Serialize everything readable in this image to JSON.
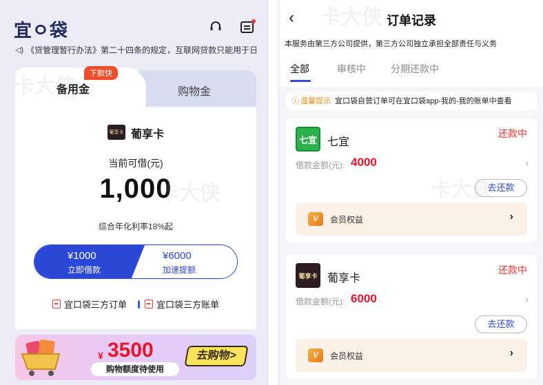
{
  "left": {
    "logo": "宜ㅇ袋",
    "notice_text": "《贷管理暂行办法》第二十四条的规定，互联网贷款只能用于日常",
    "tabs": {
      "active": "备用金",
      "active_tag": "下款快",
      "inactive": "购物金"
    },
    "card": {
      "logo_text": "葡享卡",
      "name": "葡享卡",
      "credit_label": "当前可借(元)",
      "credit_amount": "1,000",
      "rate": "综合年化利率18%起",
      "borrow_amount": "¥1000",
      "borrow_label": "立即借款",
      "boost_amount": "¥6000",
      "boost_label": "加速提额",
      "link_orders": "宜口袋三方订单",
      "link_bills": "宜口袋三方账单"
    },
    "banner": {
      "currency": "¥",
      "amount": "3500",
      "subtitle": "购物额度待使用",
      "cta": "去购物>"
    }
  },
  "right": {
    "title": "订单记录",
    "disclaimer": "本服务由第三方公司提供，第三方公司独立承担全部责任与义务",
    "tabs": [
      "全部",
      "审核中",
      "分期还款中"
    ],
    "tip_key": "温馨提示",
    "tip_text": "宜口袋自营订单可在宜口袋app-我的-我的账单中查看",
    "orders": [
      {
        "logo_text": "七宜",
        "name": "七宜",
        "status": "还款中",
        "amount_label": "借款金额(元):",
        "amount": "4000",
        "repay_label": "去还款",
        "member_label": "会员权益"
      },
      {
        "logo_text": "葡享卡",
        "name": "葡享卡",
        "status": "还款中",
        "amount_label": "借款金额(元):",
        "amount": "6000",
        "repay_label": "去还款",
        "member_label": "会员权益"
      }
    ]
  },
  "icons": [
    "headset-icon",
    "message-icon",
    "speaker-icon",
    "doc-icon",
    "shopping-cart-icon",
    "back-icon",
    "warning-icon",
    "chevron-right-icon",
    "vip-icon"
  ],
  "colors": {
    "primary_blue": "#2b47d6",
    "alert_red": "#e8322d",
    "amount_red": "#e8142b",
    "tag_orange": "#f04d2a",
    "tip_orange": "#f08a1e"
  }
}
